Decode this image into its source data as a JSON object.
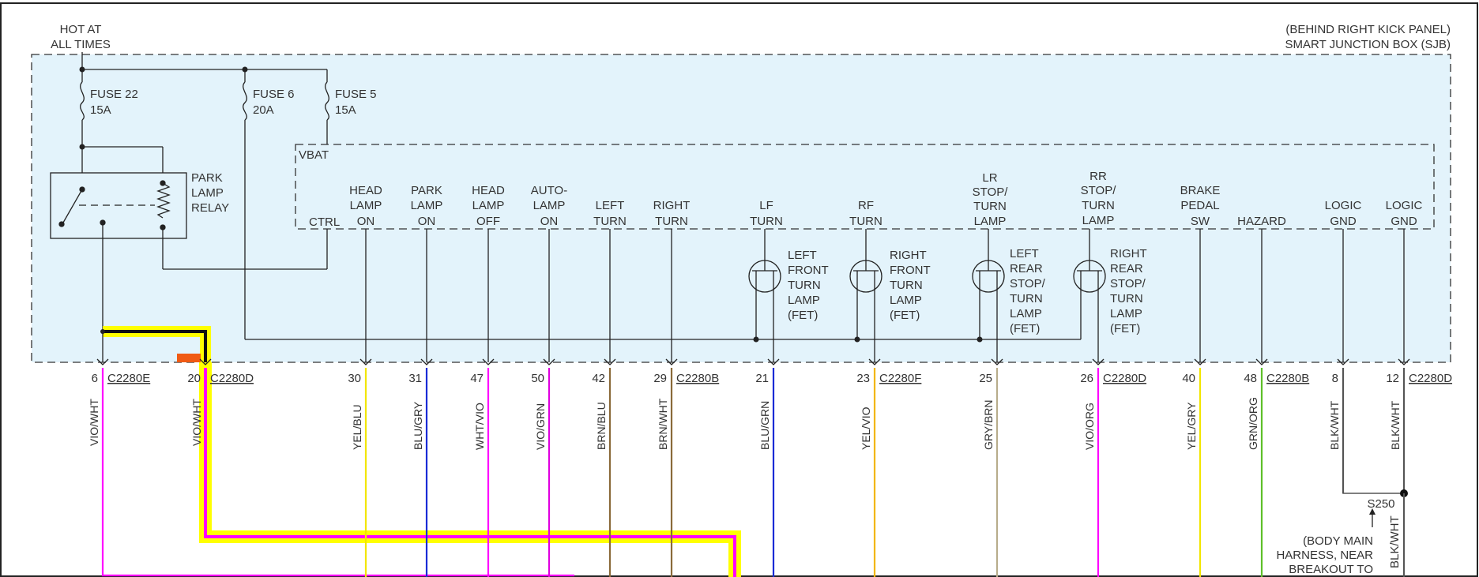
{
  "header": {
    "hot_line1": "HOT AT",
    "hot_line2": "ALL TIMES",
    "box_line1": "(BEHIND RIGHT KICK PANEL)",
    "box_line2": "SMART JUNCTION BOX (SJB)"
  },
  "fuses": [
    {
      "name": "FUSE 22",
      "rating": "15A"
    },
    {
      "name": "FUSE 6",
      "rating": "20A"
    },
    {
      "name": "FUSE 5",
      "rating": "15A"
    }
  ],
  "relay": {
    "line1": "PARK",
    "line2": "LAMP",
    "line3": "RELAY"
  },
  "vbat": "VBAT",
  "module_inputs": {
    "ctrl": "CTRL",
    "head_on": [
      "HEAD",
      "LAMP",
      "ON"
    ],
    "park_on": [
      "PARK",
      "LAMP",
      "ON"
    ],
    "head_off": [
      "HEAD",
      "LAMP",
      "OFF"
    ],
    "auto_on": [
      "AUTO-",
      "LAMP",
      "ON"
    ],
    "left_turn": [
      "LEFT",
      "TURN"
    ],
    "right_turn": [
      "RIGHT",
      "TURN"
    ],
    "lf_turn": [
      "LF",
      "TURN"
    ],
    "rf_turn": [
      "RF",
      "TURN"
    ],
    "lr_lamp": [
      "LR",
      "STOP/",
      "TURN",
      "LAMP"
    ],
    "rr_lamp": [
      "RR",
      "STOP/",
      "TURN",
      "LAMP"
    ],
    "brake_sw": [
      "BRAKE",
      "PEDAL",
      "SW"
    ],
    "hazard": "HAZARD",
    "logic_gnd1": [
      "LOGIC",
      "GND"
    ],
    "logic_gnd2": [
      "LOGIC",
      "GND"
    ]
  },
  "fets": {
    "lf": [
      "LEFT",
      "FRONT",
      "TURN",
      "LAMP",
      "(FET)"
    ],
    "rf": [
      "RIGHT",
      "FRONT",
      "TURN",
      "LAMP",
      "(FET)"
    ],
    "lr": [
      "LEFT",
      "REAR",
      "STOP/",
      "TURN",
      "LAMP",
      "(FET)"
    ],
    "rr": [
      "RIGHT",
      "REAR",
      "STOP/",
      "TURN",
      "LAMP",
      "(FET)"
    ]
  },
  "pins": [
    {
      "pin": "6",
      "connector": "C2280E",
      "wire": "VIO/WHT",
      "color": "#ff00ff"
    },
    {
      "pin": "20",
      "connector": "C2280D",
      "wire": "VIO/WHT",
      "color": "#ff00ff"
    },
    {
      "pin": "30",
      "connector": "",
      "wire": "YEL/BLU",
      "color": "#f2e600"
    },
    {
      "pin": "31",
      "connector": "",
      "wire": "BLU/GRY",
      "color": "#1a2bd6"
    },
    {
      "pin": "47",
      "connector": "",
      "wire": "WHT/VIO",
      "color": "#ff00ff"
    },
    {
      "pin": "50",
      "connector": "",
      "wire": "VIO/GRN",
      "color": "#e000e0"
    },
    {
      "pin": "42",
      "connector": "",
      "wire": "BRN/BLU",
      "color": "#8a6a3a"
    },
    {
      "pin": "29",
      "connector": "C2280B",
      "wire": "BRN/WHT",
      "color": "#8a6a3a"
    },
    {
      "pin": "21",
      "connector": "",
      "wire": "BLU/GRN",
      "color": "#1a2bd6"
    },
    {
      "pin": "23",
      "connector": "C2280F",
      "wire": "YEL/VIO",
      "color": "#f2b600"
    },
    {
      "pin": "25",
      "connector": "",
      "wire": "GRY/BRN",
      "color": "#b8ad8c"
    },
    {
      "pin": "26",
      "connector": "C2280D",
      "wire": "VIO/ORG",
      "color": "#ff00ff"
    },
    {
      "pin": "40",
      "connector": "",
      "wire": "YEL/GRY",
      "color": "#f2e600"
    },
    {
      "pin": "48",
      "connector": "C2280B",
      "wire": "GRN/ORG",
      "color": "#5fc02a"
    },
    {
      "pin": "8",
      "connector": "",
      "wire": "BLK/WHT",
      "color": "#555555"
    },
    {
      "pin": "12",
      "connector": "C2280D",
      "wire": "BLK/WHT",
      "color": "#555555"
    }
  ],
  "splice": {
    "name": "S250",
    "wire": "BLK/WHT",
    "note_line1": "(BODY MAIN",
    "note_line2": "HARNESS, NEAR",
    "note_line3": "BREAKOUT TO"
  },
  "colors": {
    "box_fill": "#e3f3fb",
    "highlight": "#ffff00",
    "marker": "#f05a14"
  }
}
